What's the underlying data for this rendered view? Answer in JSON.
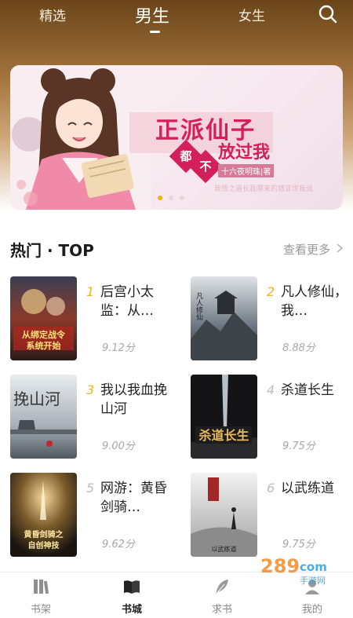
{
  "topnav": {
    "tabs": [
      {
        "label": "精选",
        "active": false
      },
      {
        "label": "男生",
        "active": true
      },
      {
        "label": "女生",
        "active": false
      }
    ],
    "search_icon": "search-icon"
  },
  "banner": {
    "title": "正派仙子",
    "char1": "都",
    "char2": "不",
    "subtitle": "放过我",
    "author": "十六夜明珠|著",
    "faint_text": "我悟之道长我哪来的错亚世我说",
    "dot_count": 3,
    "active_dot": 0,
    "accent_color": "#d4205a"
  },
  "section": {
    "title": "热门 · TOP",
    "more": "查看更多"
  },
  "books": [
    {
      "rank": "1",
      "title": "后宫小太监：从…",
      "score": "9.12分",
      "cover_text": "从绑定战令系统开始"
    },
    {
      "rank": "2",
      "title": "凡人修仙，我…",
      "score": "8.88分",
      "cover_text": "凡人修仙"
    },
    {
      "rank": "3",
      "title": "我以我血挽山河",
      "score": "9.00分",
      "cover_text": "挽山河"
    },
    {
      "rank": "4",
      "title": "杀道长生",
      "score": "9.75分",
      "cover_text": "杀道长生"
    },
    {
      "rank": "5",
      "title": "网游：黄昏剑骑…",
      "score": "9.62分",
      "cover_text": "黄昏剑骑之自创神技"
    },
    {
      "rank": "6",
      "title": "以武练道",
      "score": "9.75分",
      "cover_text": "以武练道"
    }
  ],
  "tabbar": {
    "items": [
      {
        "label": "书架",
        "icon": "bookshelf-icon",
        "active": false
      },
      {
        "label": "书城",
        "icon": "book-open-icon",
        "active": true
      },
      {
        "label": "求书",
        "icon": "feather-icon",
        "active": false
      },
      {
        "label": "我的",
        "icon": "user-icon",
        "active": false
      }
    ]
  },
  "watermark": {
    "brand": "289",
    "suffix": "com",
    "sub": "手游网"
  },
  "colors": {
    "rank_top": "#f2b21b",
    "rank_other": "#bdbdbd",
    "score": "#a6a6a6"
  }
}
